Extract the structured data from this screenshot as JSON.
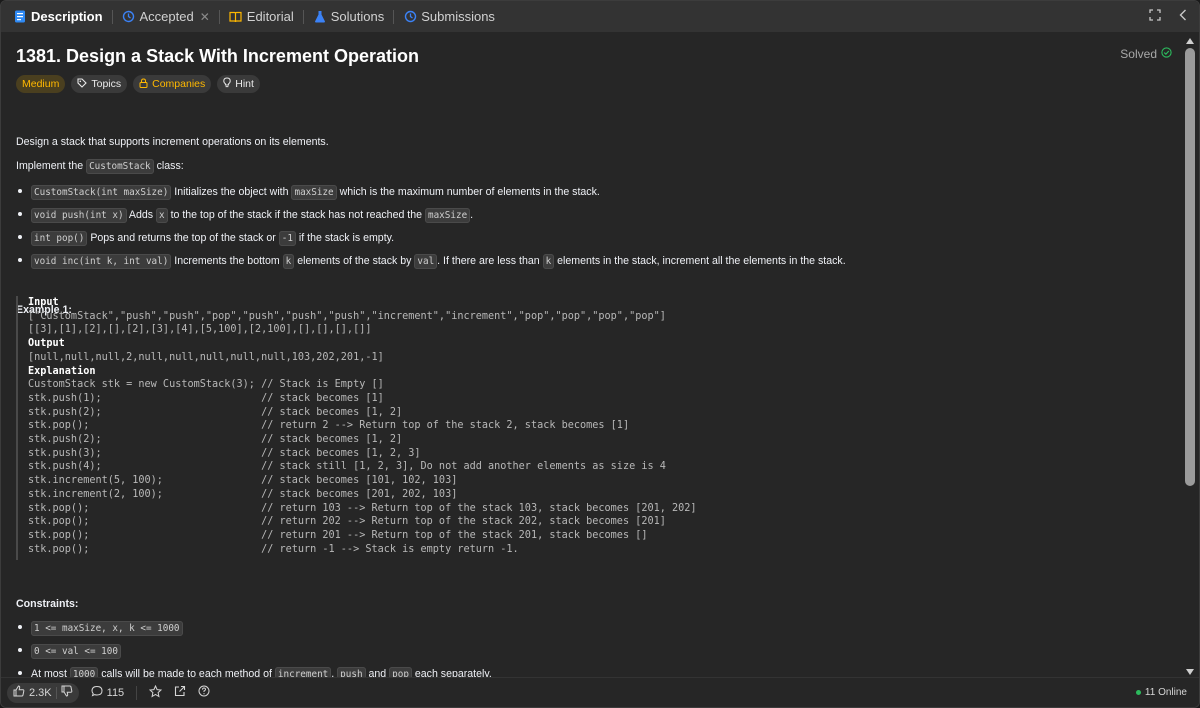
{
  "tabs": [
    {
      "label": "Description",
      "icon": "description-icon"
    },
    {
      "label": "Accepted",
      "icon": "history-icon"
    },
    {
      "label": "Editorial",
      "icon": "book-icon"
    },
    {
      "label": "Solutions",
      "icon": "flask-icon"
    },
    {
      "label": "Submissions",
      "icon": "history-icon"
    }
  ],
  "problem": {
    "title": "1381. Design a Stack With Increment Operation",
    "status": "Solved",
    "difficulty": "Medium",
    "chips": {
      "topics": "Topics",
      "companies": "Companies",
      "hint": "Hint"
    }
  },
  "description": {
    "intro": "Design a stack that supports increment operations on its elements.",
    "implement_pre": "Implement the ",
    "implement_code": "CustomStack",
    "implement_post": " class:",
    "bullets": [
      {
        "c1": "CustomStack(int maxSize)",
        "t1": " Initializes the object with ",
        "c2": "maxSize",
        "t2": " which is the maximum number of elements in the stack."
      },
      {
        "c1": "void push(int x)",
        "t1": " Adds ",
        "c2": "x",
        "t2": " to the top of the stack if the stack has not reached the ",
        "c3": "maxSize",
        "t3": "."
      },
      {
        "c1": "int pop()",
        "t1": " Pops and returns the top of the stack or ",
        "c2": "-1",
        "t2": " if the stack is empty."
      },
      {
        "c1": "void inc(int k, int val)",
        "t1": " Increments the bottom ",
        "c2": "k",
        "t2": " elements of the stack by ",
        "c3": "val",
        "t3": ". If there are less than ",
        "c4": "k",
        "t4": " elements in the stack, increment all the elements in the stack."
      }
    ],
    "example_heading": "Example 1:",
    "example": {
      "input_label": "Input",
      "input_line1": "[\"CustomStack\",\"push\",\"push\",\"pop\",\"push\",\"push\",\"push\",\"increment\",\"increment\",\"pop\",\"pop\",\"pop\",\"pop\"]",
      "input_line2": "[[3],[1],[2],[],[2],[3],[4],[5,100],[2,100],[],[],[],[]]",
      "output_label": "Output",
      "output_line": "[null,null,null,2,null,null,null,null,null,103,202,201,-1]",
      "explanation_label": "Explanation",
      "explanation_lines": [
        "CustomStack stk = new CustomStack(3); // Stack is Empty []",
        "stk.push(1);                          // stack becomes [1]",
        "stk.push(2);                          // stack becomes [1, 2]",
        "stk.pop();                            // return 2 --> Return top of the stack 2, stack becomes [1]",
        "stk.push(2);                          // stack becomes [1, 2]",
        "stk.push(3);                          // stack becomes [1, 2, 3]",
        "stk.push(4);                          // stack still [1, 2, 3], Do not add another elements as size is 4",
        "stk.increment(5, 100);                // stack becomes [101, 102, 103]",
        "stk.increment(2, 100);                // stack becomes [201, 202, 103]",
        "stk.pop();                            // return 103 --> Return top of the stack 103, stack becomes [201, 202]",
        "stk.pop();                            // return 202 --> Return top of the stack 202, stack becomes [201]",
        "stk.pop();                            // return 201 --> Return top of the stack 201, stack becomes []",
        "stk.pop();                            // return -1 --> Stack is empty return -1."
      ]
    },
    "constraints_heading": "Constraints:",
    "constraints": [
      {
        "code": "1 <= maxSize, x, k <= 1000"
      },
      {
        "code": "0 <= val <= 100"
      }
    ],
    "constraint3": {
      "t0": "At most ",
      "c1": "1000",
      "t1": " calls will be made to each method of ",
      "c2": "increment",
      "t2": ", ",
      "c3": "push",
      "t3": " and ",
      "c4": "pop",
      "t4": " each separately."
    }
  },
  "footer": {
    "likes": "2.3K",
    "comments": "115",
    "online": "11 Online"
  },
  "colors": {
    "medium": "#ffb800",
    "solved_check": "#2cbb5d",
    "online_dot": "#2cbb5d"
  }
}
